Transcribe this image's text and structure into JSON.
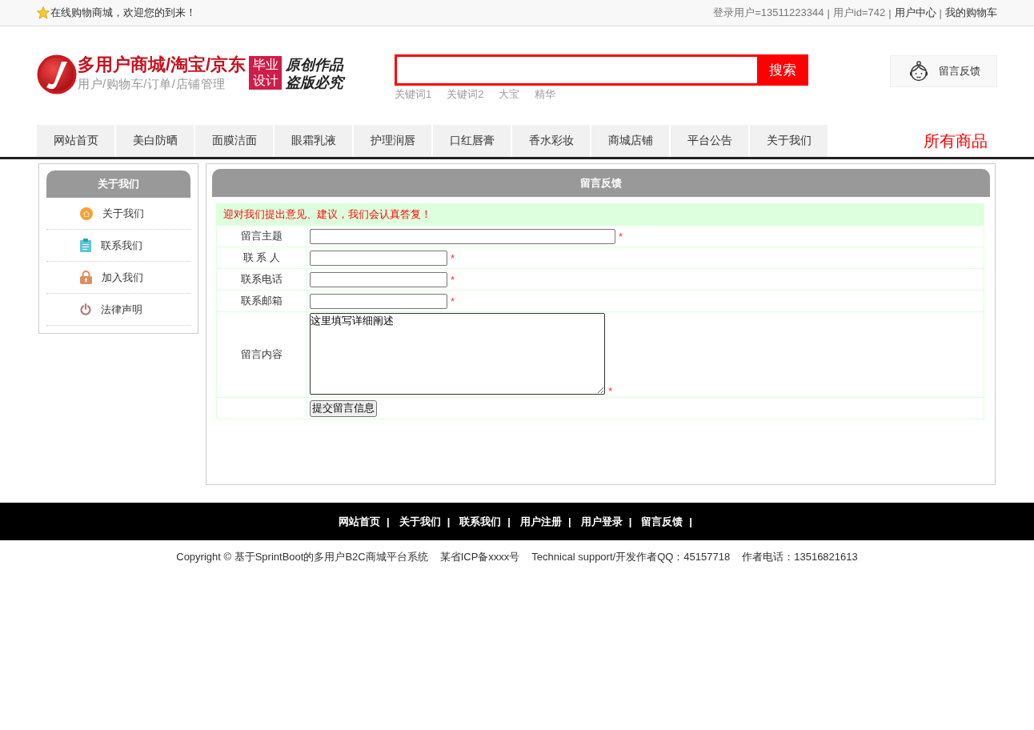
{
  "top_bar": {
    "welcome": "在线购物商城，欢迎您的到来！",
    "separator": "|",
    "user_links": [
      {
        "text": "登录用户=13511223344",
        "kind": "info"
      },
      {
        "text": "用户id=742",
        "kind": "info"
      },
      {
        "text": "用户中心",
        "kind": "link"
      },
      {
        "text": "我的购物车",
        "kind": "link"
      }
    ]
  },
  "header": {
    "logo": {
      "title": "多用户商城/淘宝/京东",
      "subtitle": "用户/购物车/订单/店铺管理",
      "badge": "毕业设计",
      "slogan": [
        "原创作品",
        "盗版必究"
      ]
    },
    "search": {
      "button": "搜索",
      "keywords": [
        "关键词1",
        "关键词2",
        "大宝",
        "精华"
      ]
    },
    "feedback_button": "留言反馈"
  },
  "nav": {
    "items": [
      "网站首页",
      "美白防晒",
      "面膜洁面",
      "眼霜乳液",
      "护理润唇",
      "口红唇膏",
      "香水彩妆",
      "商城店铺",
      "平台公告",
      "关于我们"
    ],
    "all_products": "所有商品"
  },
  "sidebar": {
    "title": "关于我们",
    "items": [
      {
        "label": "关于我们",
        "kind": "home"
      },
      {
        "label": "联系我们",
        "kind": "clipboard"
      },
      {
        "label": "加入我们",
        "kind": "lock"
      },
      {
        "label": "法律声明",
        "kind": "power"
      }
    ]
  },
  "main": {
    "title": "留言反馈",
    "form": {
      "notice": "迎对我们提出意见、建议，我们会认真答复！",
      "rows": [
        {
          "label": "留言主题",
          "kind": "long-input",
          "required_mark": "*"
        },
        {
          "label": "联 系 人",
          "kind": "short-input",
          "required_mark": "*"
        },
        {
          "label": "联系电话",
          "kind": "short-input",
          "required_mark": "*"
        },
        {
          "label": "联系邮箱",
          "kind": "short-input",
          "required_mark": "*"
        },
        {
          "label": "留言内容",
          "kind": "textarea",
          "value": "这里填写详细阐述",
          "required_mark": "*"
        }
      ],
      "submit": "提交留言信息"
    }
  },
  "footer": {
    "separator": "|",
    "links": [
      "网站首页",
      "关于我们",
      "联系我们",
      "用户注册",
      "用户登录",
      "留言反馈"
    ],
    "copyright": [
      "Copyright © 基于SprintBoot的多用户B2C商城平台系统",
      "某省ICP备xxxx号",
      "Technical support/开发作者QQ：45157718",
      "作者电话：13516821613"
    ]
  }
}
